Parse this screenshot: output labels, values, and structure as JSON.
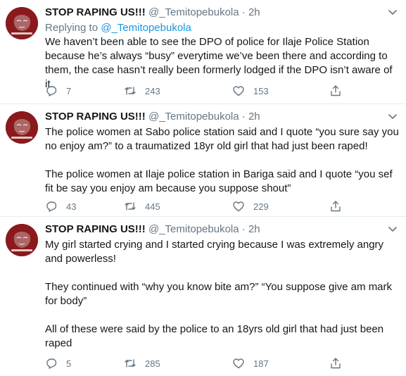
{
  "tweets": [
    {
      "name": "STOP RAPING US!!!",
      "handle": "@_Temitopebukola",
      "dot": "·",
      "time": "2h",
      "replying_to_prefix": "Replying to ",
      "replying_to": "@_Temitopebukola",
      "paragraphs": [
        "We haven’t been able to see the DPO of police for Ilaje Police Station because he’s always “busy” everytime we’ve been there and according to them, the case hasn’t really been formerly lodged if the DPO isn’t aware of it."
      ],
      "replies": "7",
      "retweets": "243",
      "likes": "153"
    },
    {
      "name": "STOP RAPING US!!!",
      "handle": "@_Temitopebukola",
      "dot": "·",
      "time": "2h",
      "paragraphs": [
        "The police women at Sabo police station said and I quote “you sure say you no enjoy am?” to a traumatized 18yr old girl that had just been raped!",
        "The police women at Ilaje police station in Bariga said and I quote “you sef fit be say you enjoy am because you suppose shout”"
      ],
      "replies": "43",
      "retweets": "445",
      "likes": "229"
    },
    {
      "name": "STOP RAPING US!!!",
      "handle": "@_Temitopebukola",
      "dot": "·",
      "time": "2h",
      "paragraphs": [
        "My girl started crying and I started crying because I was extremely angry and powerless!",
        "They continued with “why you know bite am?” “You suppose give am mark for body”",
        "All of these were said by the police to an 18yrs old girl that had just been raped"
      ],
      "replies": "5",
      "retweets": "285",
      "likes": "187"
    }
  ],
  "avatar_text": "#JusticeforVera",
  "colors": {
    "avatar": "#8b1a1d",
    "muted": "#657786",
    "link": "#1b95e0",
    "text": "#14171a"
  },
  "icons": [
    "avatar",
    "chevron-down-icon",
    "reply-icon",
    "retweet-icon",
    "like-icon",
    "share-icon"
  ]
}
